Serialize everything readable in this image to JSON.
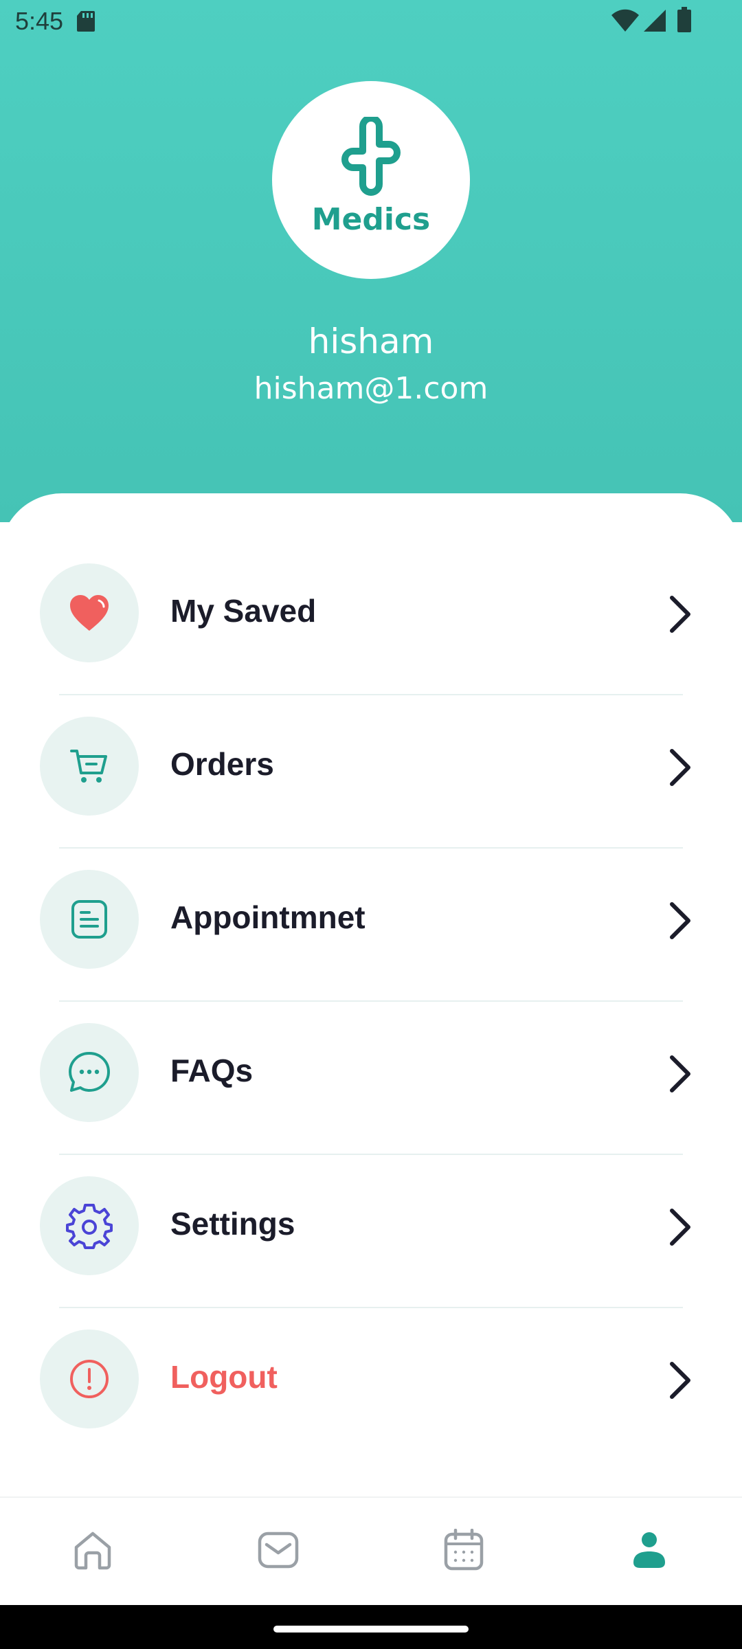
{
  "status_bar": {
    "time": "5:45",
    "icons": [
      "sd-card-icon",
      "wifi-icon",
      "signal-icon",
      "battery-icon"
    ]
  },
  "logo": {
    "text": "Medics"
  },
  "profile": {
    "name": "hisham",
    "email": "hisham@1.com"
  },
  "menu": [
    {
      "label": "My Saved",
      "icon": "heart-icon"
    },
    {
      "label": "Orders",
      "icon": "cart-icon"
    },
    {
      "label": "Appointmnet",
      "icon": "document-icon"
    },
    {
      "label": "FAQs",
      "icon": "chat-icon"
    },
    {
      "label": "Settings",
      "icon": "gear-icon"
    },
    {
      "label": "Logout",
      "icon": "alert-icon"
    }
  ],
  "bottom_nav": [
    {
      "icon": "home-icon",
      "active": false
    },
    {
      "icon": "mail-icon",
      "active": false
    },
    {
      "icon": "calendar-icon",
      "active": false
    },
    {
      "icon": "profile-icon",
      "active": true
    }
  ],
  "colors": {
    "header": "#4ecfc1",
    "accent": "#1f9f8e",
    "logout": "#f0605e",
    "settings_icon": "#4a44d6",
    "heart": "#f0605e"
  }
}
